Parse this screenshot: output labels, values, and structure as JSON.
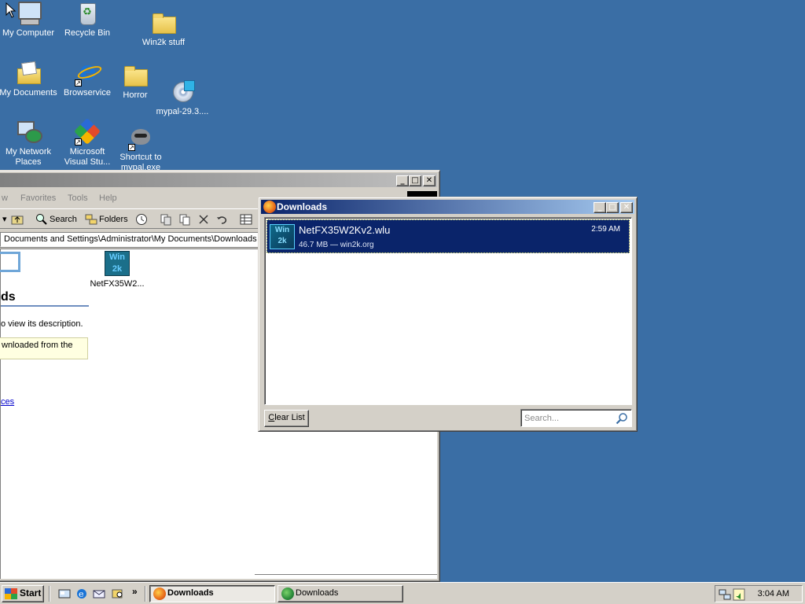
{
  "desktop": {
    "background_color": "#3a6ea5",
    "icons": [
      {
        "label": "My Computer",
        "icon": "computer-icon"
      },
      {
        "label": "Recycle Bin",
        "icon": "recycle-bin-icon"
      },
      {
        "label": "Win2k stuff",
        "icon": "folder-icon"
      },
      {
        "label": "My Documents",
        "icon": "my-documents-icon"
      },
      {
        "label": "Browservice",
        "icon": "internet-explorer-icon"
      },
      {
        "label": "Horror",
        "icon": "folder-icon"
      },
      {
        "label": "mypal-29.3....",
        "icon": "installer-cd-icon"
      },
      {
        "label": "My Network Places",
        "icon": "network-places-icon"
      },
      {
        "label": "Microsoft Visual Stu...",
        "icon": "visual-studio-icon"
      },
      {
        "label": "Shortcut to mypal.exe",
        "icon": "mypal-raccoon-icon"
      }
    ]
  },
  "explorer": {
    "menu": [
      "w",
      "Favorites",
      "Tools",
      "Help"
    ],
    "toolbar": {
      "search_label": "Search",
      "folders_label": "Folders"
    },
    "address": "Documents and Settings\\Administrator\\My Documents\\Downloads",
    "folder_heading": "ds",
    "description": "o view its description.",
    "info_text": "wnloaded from the",
    "link_text": "ces",
    "file_label": "NetFX35W2..."
  },
  "downloads": {
    "title": "Downloads",
    "items": [
      {
        "name": "NetFX35W2Kv2.wlu",
        "meta": "46.7 MB — win2k.org",
        "time": "2:59 AM",
        "thumb_text": "Win 2k"
      }
    ],
    "clear_label": "Clear List",
    "clear_accesskey": "C",
    "search_placeholder": "Search..."
  },
  "taskbar": {
    "start_label": "Start",
    "tasks": [
      {
        "label": "Downloads",
        "active": true
      },
      {
        "label": "Downloads",
        "active": false
      }
    ],
    "clock": "3:04 AM",
    "chevron": "»"
  }
}
